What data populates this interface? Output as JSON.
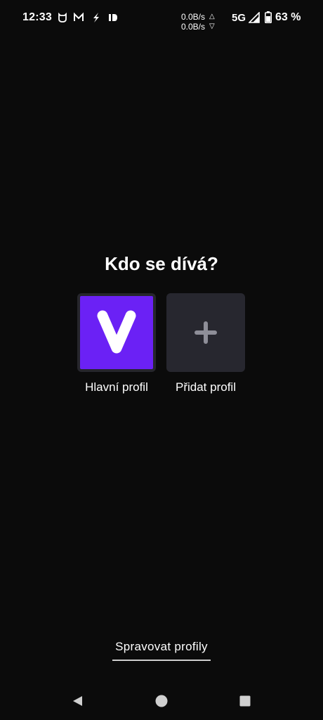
{
  "status_bar": {
    "time": "12:33",
    "notification_icons": [
      "xiaomi-icon",
      "gmail-icon",
      "bolt-icon",
      "app-id-icon"
    ],
    "upload_speed": "0.0B/s",
    "download_speed": "0.0B/s",
    "upload_arrow": "△",
    "download_arrow": "▽",
    "network_type": "5G",
    "battery_percent": "63 %"
  },
  "main": {
    "title": "Kdo se dívá?",
    "profiles": [
      {
        "label": "Hlavní profil",
        "avatar_letter": "V",
        "color": "#6b21f5",
        "icon": "v-logo-icon"
      },
      {
        "label": "Přidat profil",
        "color": "#27272f",
        "icon": "plus-icon"
      }
    ]
  },
  "footer": {
    "manage_label": "Spravovat profily"
  },
  "nav_bar": {
    "buttons": [
      "back-icon",
      "home-icon",
      "recents-icon"
    ]
  },
  "colors": {
    "background": "#0b0b0b",
    "accent": "#6b21f5",
    "tile": "#27272f"
  }
}
